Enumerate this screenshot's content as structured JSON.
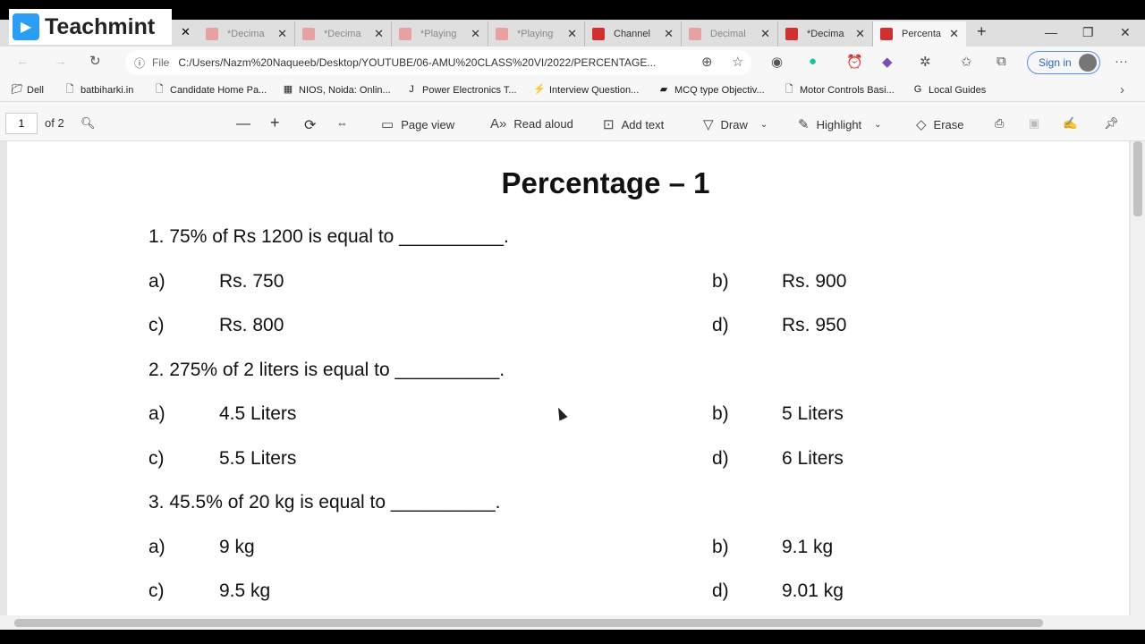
{
  "logo": {
    "text": "Teachmint"
  },
  "tabs": [
    {
      "label": "*Decima"
    },
    {
      "label": "*Decima"
    },
    {
      "label": "*Playing"
    },
    {
      "label": "*Playing"
    },
    {
      "label": "Channel"
    },
    {
      "label": "Decimal"
    },
    {
      "label": "*Decima"
    },
    {
      "label": "Percenta"
    }
  ],
  "address": {
    "scheme": "File",
    "url": "C:/Users/Nazm%20Naqueeb/Desktop/YOUTUBE/06-AMU%20CLASS%20VI/2022/PERCENTAGE...",
    "sign_in": "Sign in"
  },
  "bookmarks": [
    "Dell",
    "batbiharki.in",
    "Candidate Home Pa...",
    "NIOS, Noida: Onlin...",
    "Power Electronics T...",
    "Interview Question...",
    "MCQ type Objectiv...",
    "Motor Controls Basi...",
    "Local Guides"
  ],
  "pdf_toolbar": {
    "page": "1",
    "of": "of 2",
    "page_view": "Page view",
    "read_aloud": "Read aloud",
    "add_text": "Add text",
    "draw": "Draw",
    "highlight": "Highlight",
    "erase": "Erase"
  },
  "document": {
    "title": "Percentage – 1",
    "questions": [
      {
        "q": "1. 75% of Rs 1200 is equal to __________.",
        "a": "Rs. 750",
        "b": "Rs. 900",
        "c": "Rs. 800",
        "d": "Rs. 950"
      },
      {
        "q": "2. 275% of 2 liters is equal to __________.",
        "a": "4.5 Liters",
        "b": "5 Liters",
        "c": "5.5 Liters",
        "d": "6 Liters"
      },
      {
        "q": "3. 45.5% of 20 kg is equal to __________.",
        "a": "9 kg",
        "b": "9.1 kg",
        "c": "9.5 kg",
        "d": "9.01 kg"
      }
    ],
    "labels": {
      "a": "a)",
      "b": "b)",
      "c": "c)",
      "d": "d)"
    }
  }
}
